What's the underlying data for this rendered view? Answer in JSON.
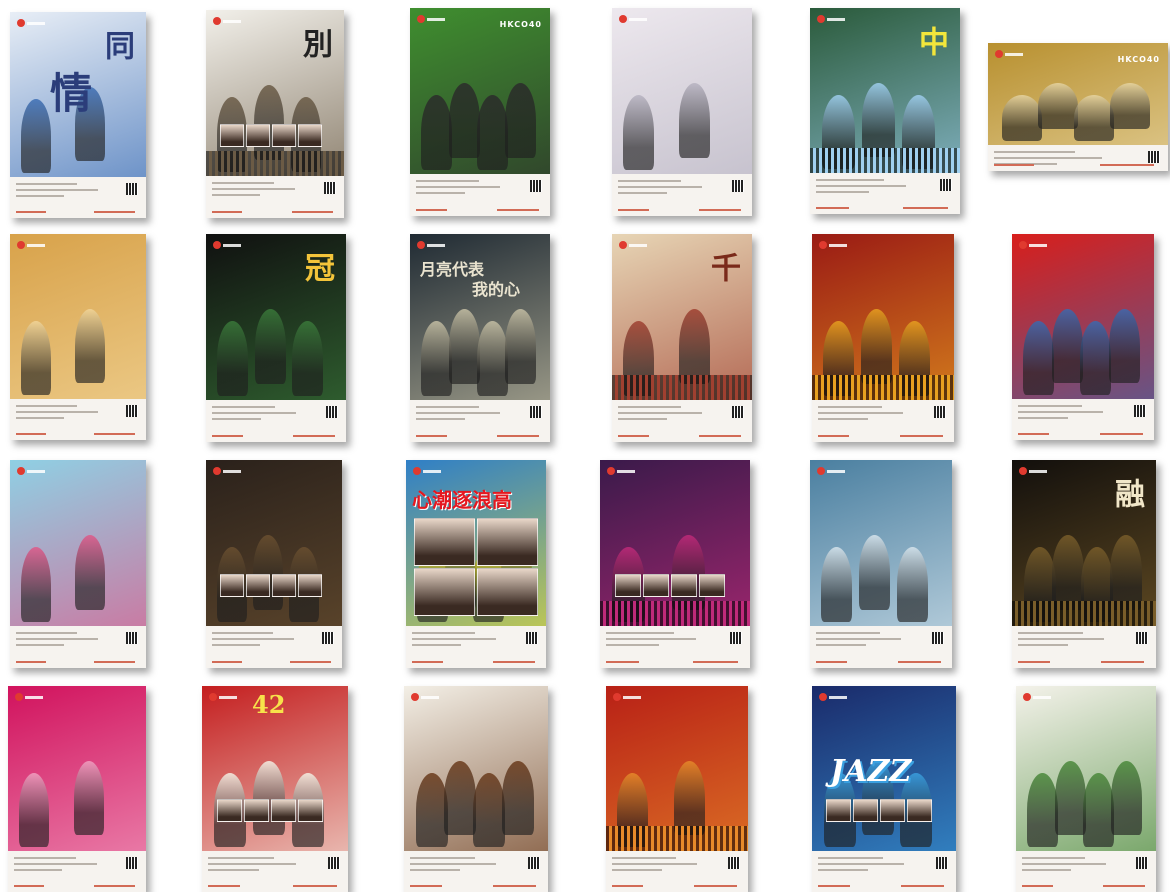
{
  "posters": [
    {
      "title": "同",
      "title2": "情",
      "bg": "#e8eef6",
      "fg": "#2b3d7a",
      "accent": "#3d6fb6",
      "tag": ""
    },
    {
      "title": "別",
      "title2": "",
      "bg": "#f2f0ea",
      "fg": "#222222",
      "accent": "#6b5b45",
      "tag": ""
    },
    {
      "title": "",
      "title2": "",
      "bg": "#3f8f2f",
      "fg": "#ffffff",
      "accent": "#2b2b2b",
      "tag": "HKCO40"
    },
    {
      "title": "",
      "title2": "",
      "bg": "#ede8ee",
      "fg": "#8b2a8c",
      "accent": "#b8b4c2",
      "tag": ""
    },
    {
      "title": "中",
      "title2": "",
      "bg": "#2a5a3a",
      "fg": "#f3e63b",
      "accent": "#a0d0f0",
      "tag": ""
    },
    {
      "title": "",
      "title2": "",
      "bg": "#b8902f",
      "fg": "#ffffff",
      "accent": "#e8d6a3",
      "tag": "HKCO40"
    },
    {
      "title": "",
      "title2": "",
      "bg": "#d8a24a",
      "fg": "#6b2a1a",
      "accent": "#f2d69a",
      "tag": ""
    },
    {
      "title": "冠",
      "title2": "",
      "bg": "#101010",
      "fg": "#f3c43a",
      "accent": "#3a7a3a",
      "tag": ""
    },
    {
      "title": "月亮代表",
      "title2": "我的心",
      "bg": "#1f2a33",
      "fg": "#e9e3cf",
      "accent": "#c7c1a6",
      "tag": ""
    },
    {
      "title": "千",
      "title2": "",
      "bg": "#e7d5b5",
      "fg": "#7a2a1a",
      "accent": "#a04030",
      "tag": ""
    },
    {
      "title": "",
      "title2": "",
      "bg": "#9a1a14",
      "fg": "#f3d16a",
      "accent": "#e8a020",
      "tag": ""
    },
    {
      "title": "",
      "title2": "",
      "bg": "#d81e1b",
      "fg": "#f7e04a",
      "accent": "#3b6ab0",
      "tag": ""
    },
    {
      "title": "",
      "title2": "",
      "bg": "#8fd0e4",
      "fg": "#2a6aa0",
      "accent": "#e05a8a",
      "tag": ""
    },
    {
      "title": "",
      "title2": "",
      "bg": "#2a211b",
      "fg": "#e8d8b0",
      "accent": "#6b5030",
      "tag": ""
    },
    {
      "title": "心潮逐浪高",
      "title2": "",
      "bg": "#2f7fc7",
      "fg": "#e5171f",
      "accent": "#f2e12a",
      "tag": ""
    },
    {
      "title": "",
      "title2": "",
      "bg": "#3a1a4a",
      "fg": "#f3d24a",
      "accent": "#c02a7a",
      "tag": ""
    },
    {
      "title": "",
      "title2": "",
      "bg": "#4a7fa0",
      "fg": "#ffffff",
      "accent": "#d8e6ee",
      "tag": ""
    },
    {
      "title": "融",
      "title2": "",
      "bg": "#120f0c",
      "fg": "#f1e6c8",
      "accent": "#7a5e2a",
      "tag": ""
    },
    {
      "title": "",
      "title2": "",
      "bg": "#d1125d",
      "fg": "#ffffff",
      "accent": "#f2a1c2",
      "tag": ""
    },
    {
      "title": "42",
      "title2": "",
      "bg": "#c41e1f",
      "fg": "#f7e24a",
      "accent": "#f7f2e6",
      "tag": ""
    },
    {
      "title": "",
      "title2": "",
      "bg": "#f3efe6",
      "fg": "#2a2220",
      "accent": "#6b3a1a",
      "tag": ""
    },
    {
      "title": "",
      "title2": "",
      "bg": "#b82016",
      "fg": "#f4c240",
      "accent": "#e88a2a",
      "tag": ""
    },
    {
      "title": "JAZZ",
      "title2": "",
      "bg": "#1a2a6a",
      "fg": "#ffffff",
      "accent": "#3aa0e0",
      "tag": ""
    },
    {
      "title": "",
      "title2": "",
      "bg": "#f4f2ea",
      "fg": "#2a2a2a",
      "accent": "#4a8a3a",
      "tag": ""
    }
  ]
}
